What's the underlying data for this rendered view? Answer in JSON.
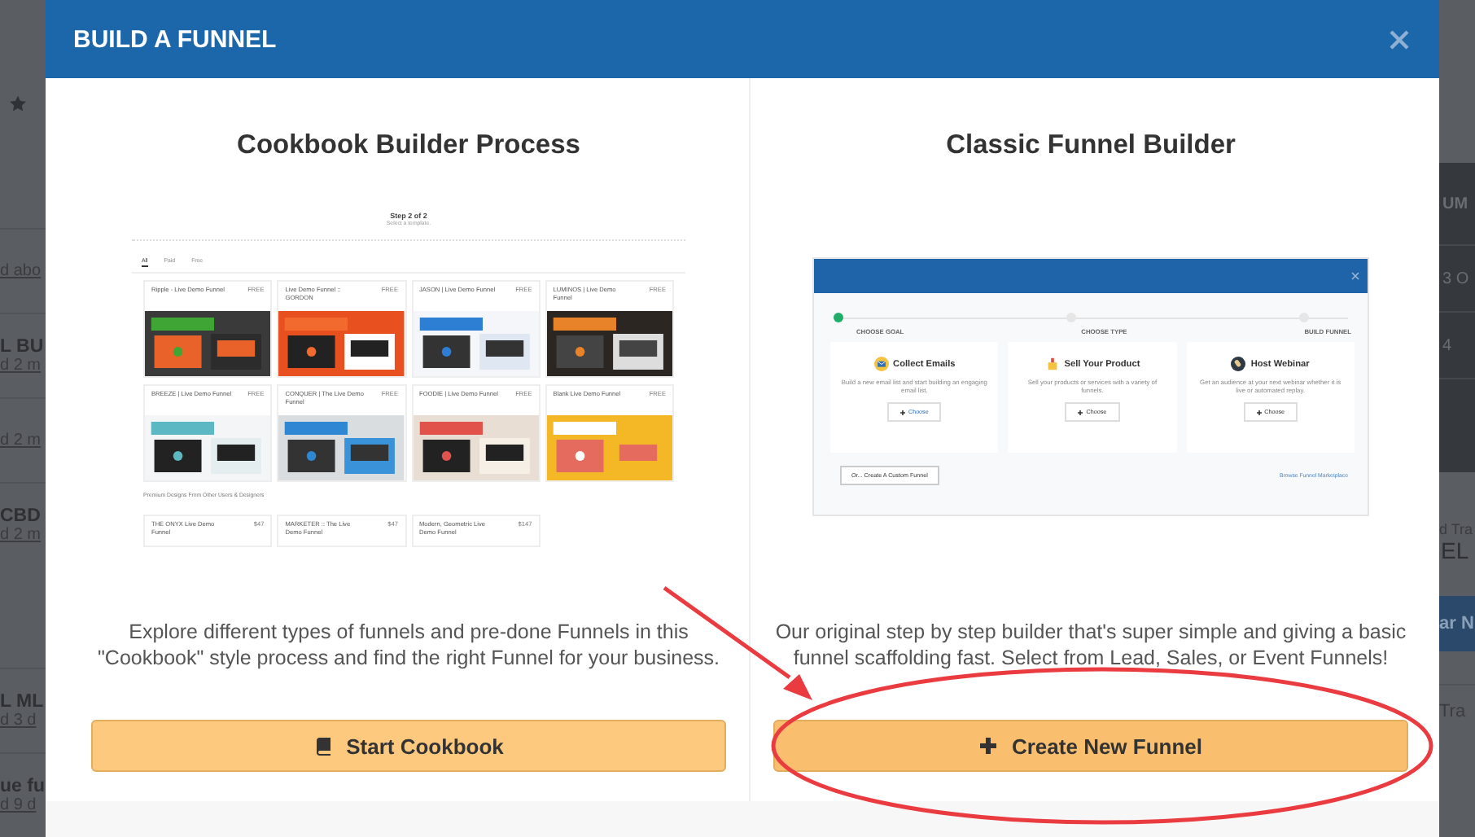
{
  "background": {
    "left_items": [
      {
        "meta": "d abo"
      },
      {
        "title": "L BU",
        "meta": "d 2 m"
      },
      {
        "meta": "d 2 m"
      },
      {
        "title": "CBD",
        "meta": "d 2 m"
      },
      {
        "title": "L ML",
        "meta": "d 3 d"
      },
      {
        "title": "ue fu",
        "meta": "d 9 d"
      }
    ],
    "right_table": {
      "header": "UM",
      "cells": [
        "3 O",
        "4"
      ]
    },
    "right_caption": "d Tra",
    "right_title": "EL",
    "right_button": "ar N",
    "right_row": "Tra"
  },
  "modal": {
    "title": "BUILD A FUNNEL",
    "options": [
      {
        "kind": "cookbook",
        "heading": "Cookbook Builder Process",
        "description": "Explore different types of funnels and pre-done Funnels in this \"Cookbook\" style process and find the right Funnel for your business.",
        "button": "Start Cookbook",
        "preview": {
          "step": "Step 2 of 2",
          "subtitle": "Select a template.",
          "tabs": [
            {
              "label": "All",
              "selected": true
            },
            {
              "label": "Paid",
              "selected": false
            },
            {
              "label": "Free",
              "selected": false
            }
          ],
          "templates": [
            {
              "name": "Ripple - Live Demo Funnel",
              "price": "FREE"
            },
            {
              "name": "Live Demo Funnel :: GORDON",
              "price": "FREE"
            },
            {
              "name": "JASON | Live Demo Funnel",
              "price": "FREE"
            },
            {
              "name": "LUMINOS | Live Demo Funnel",
              "price": "FREE"
            },
            {
              "name": "BREEZE | Live Demo Funnel",
              "price": "FREE"
            },
            {
              "name": "CONQUER | The Live Demo Funnel",
              "price": "FREE"
            },
            {
              "name": "FOODIE | Live Demo Funnel",
              "price": "FREE"
            },
            {
              "name": "Blank Live Demo Funnel",
              "price": "FREE"
            }
          ],
          "premium_heading": "Premium Designs From Other Users & Designers",
          "premium": [
            {
              "name": "THE ONYX Live Demo Funnel",
              "price": "$47"
            },
            {
              "name": "MARKETER :: The Live Demo Funnel",
              "price": "$47"
            },
            {
              "name": "Modern, Geometric Live Demo Funnel",
              "price": "$147"
            }
          ]
        }
      },
      {
        "kind": "classic",
        "heading": "Classic Funnel Builder",
        "description": "Our original step by step builder that's super simple and giving a basic funnel scaffolding fast. Select from Lead, Sales, or Event Funnels!",
        "button": "Create New Funnel",
        "annotated": true,
        "preview": {
          "steps": [
            {
              "label": "CHOOSE GOAL",
              "selected": true
            },
            {
              "label": "CHOOSE TYPE",
              "selected": false
            },
            {
              "label": "BUILD FUNNEL",
              "selected": false
            }
          ],
          "goals": [
            {
              "kind": "email",
              "title": "Collect Emails",
              "text": "Build a new email list and start building an engaging email list.",
              "button": "Choose"
            },
            {
              "kind": "product",
              "title": "Sell Your Product",
              "text": "Sell your products or services with a variety of funnels.",
              "button": "Choose"
            },
            {
              "kind": "webinar",
              "title": "Host Webinar",
              "text": "Get an audience at your next webinar whether it is live or automated replay.",
              "button": "Choose"
            }
          ],
          "custom_button": "Or... Create A Custom Funnel",
          "marketplace_link": "Browse Funnel Marketplace"
        }
      }
    ]
  }
}
